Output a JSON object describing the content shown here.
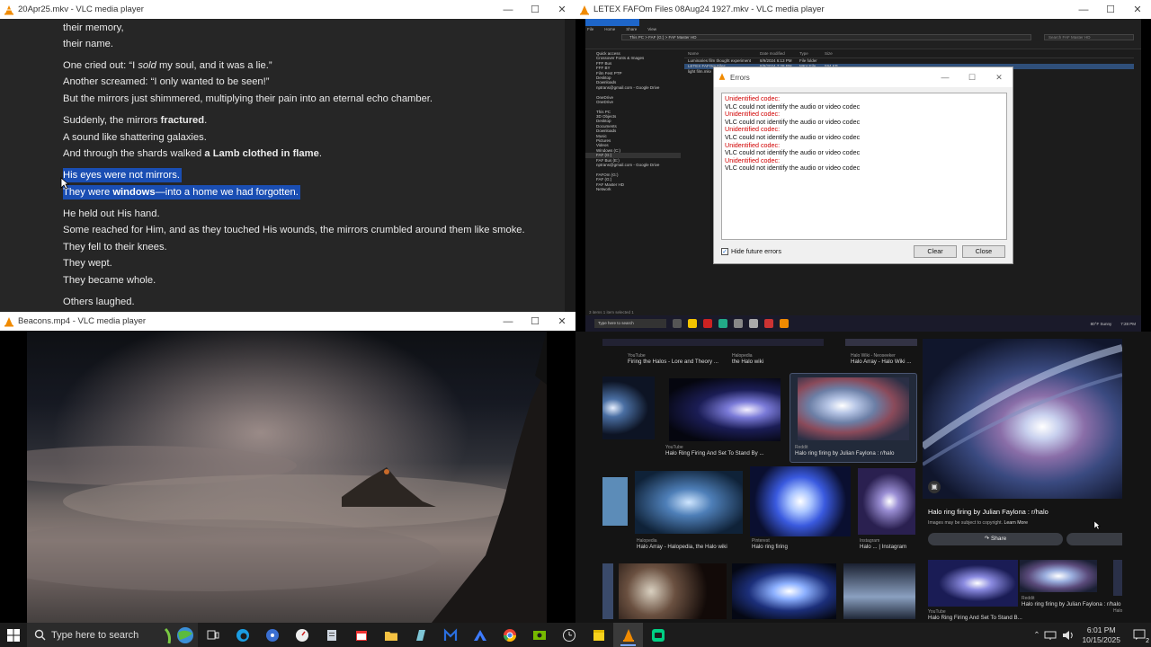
{
  "win1": {
    "title": "20Apr25.mkv - VLC media player",
    "lines": [
      {
        "t": "their memory,"
      },
      {
        "t": "their name."
      },
      {
        "parts": [
          "One cried out: “I ",
          "sold",
          " my soul, and it was a lie.”"
        ]
      },
      {
        "t": "Another screamed: “I only wanted to be seen!”"
      },
      {
        "t": "But the mirrors just shimmered, multiplying their pain into an eternal echo chamber."
      },
      {
        "parts": [
          "Suddenly, the mirrors ",
          "fractured",
          "."
        ]
      },
      {
        "t": "A sound like shattering galaxies."
      },
      {
        "parts": [
          "And through the shards walked ",
          "a Lamb clothed in flame",
          "."
        ]
      },
      {
        "t": "His eyes were not mirrors."
      },
      {
        "parts": [
          "They were ",
          "windows",
          "—into a home we had forgotten."
        ]
      },
      {
        "t": "He held out His hand."
      },
      {
        "t": "Some reached for Him, and as they touched His wounds, the mirrors crumbled around them like smoke."
      },
      {
        "t": "They fell to their knees."
      },
      {
        "t": "They wept."
      },
      {
        "t": "They became whole."
      },
      {
        "t": "Others laughed."
      }
    ]
  },
  "win2": {
    "title": "LETEX FAFOm Files 08Aug24 1927.mkv - VLC media player",
    "explorer": {
      "tabs": [
        "File",
        "Home",
        "Share",
        "View"
      ],
      "address": "This PC  >  FAF (G:)  >  FAF Master HD",
      "search": "Search FAF Master HD",
      "nav": [
        "Quick access",
        "Crossover Fonts & Images",
        "FFF Bus",
        "FFF BY",
        "Film Fest PTP",
        "Desktop",
        "Downloads",
        "nptrans@gmail.com - Google Drive",
        "",
        "OneDrive",
        "OneDrive",
        "",
        "This PC",
        "3D Objects",
        "Desktop",
        "Documents",
        "Downloads",
        "Music",
        "Pictures",
        "Videos",
        "Windows (C:)",
        "FAF (G:)",
        "FAF Bus (E:)",
        "nptrans@gmail.com - Google Drive",
        "",
        "FAFOm (G:)",
        "FAF (G:)",
        "FAF Master HD",
        "Network"
      ],
      "headers": [
        "Name",
        "Date modified",
        "Type",
        "Size"
      ],
      "rows": [
        [
          "Luminaries film thought experiment",
          "8/9/2024 6:13 PM",
          "File folder",
          ""
        ],
        [
          "LETEX FAFOm Files",
          "8/9/2024 7:28 PM",
          "MKV File",
          "594 KB"
        ],
        [
          "light film.mkv",
          "8/9/2024 7:29 PM",
          "MKV File",
          "5 KB"
        ]
      ],
      "status": "3 items    1 item selected  1",
      "taskbar_search": "Type here to search",
      "tray": [
        "80°F Sunny",
        "7:28 PM"
      ]
    },
    "dialog": {
      "title": "Errors",
      "messages": [
        {
          "err": "Unidentified codec:",
          "msg": "VLC could not identify the audio or video codec"
        },
        {
          "err": "Unidentified codec:",
          "msg": "VLC could not identify the audio or video codec"
        },
        {
          "err": "Unidentified codec:",
          "msg": "VLC could not identify the audio or video codec"
        },
        {
          "err": "Unidentified codec:",
          "msg": "VLC could not identify the audio or video codec"
        },
        {
          "err": "Unidentified codec:",
          "msg": "VLC could not identify the audio or video codec"
        }
      ],
      "hide_label": "Hide future errors",
      "hide_checked": true,
      "clear_label": "Clear",
      "close_label": "Close"
    }
  },
  "win3": {
    "title": "Beacons.mp4 - VLC media player"
  },
  "win4": {
    "results": [
      {
        "source": "YouTube",
        "title": "Firing the Halos - Lore and Theory ..."
      },
      {
        "source": "Halopedia",
        "title": "the Halo wiki"
      },
      {
        "source": "Halo Wiki - Neoseeker",
        "title": "Halo Array - Halo Wiki ..."
      },
      {
        "source": "YouTube",
        "title": "Halo Ring Firing And Set To Stand By ..."
      },
      {
        "source": "Reddit",
        "title": "Halo ring firing by Julian Faylona : r/halo"
      },
      {
        "source": "Halopedia",
        "title": "Halo Array - Halopedia, the Halo wiki"
      },
      {
        "source": "Pinterest",
        "title": "Halo ring firing"
      },
      {
        "source": "Instagram",
        "title": "Halo ... | Instagram"
      },
      {
        "source": "YouTube",
        "title": "Halo Ring Firing And Set To Stand B..."
      },
      {
        "source": "Reddit",
        "title": "Halo ring firing by Julian Faylona : r/halo"
      },
      {
        "source": "Halo",
        "title": ""
      }
    ],
    "preview": {
      "title": "Halo ring firing by Julian Faylona : r/halo",
      "note_prefix": "Images may be subject to copyright. ",
      "note_link": "Learn More",
      "share_label": "Share"
    }
  },
  "taskbar": {
    "search_placeholder": "Type here to search",
    "time": "6:01 PM",
    "date": "10/15/2025",
    "notification_count": "2"
  }
}
